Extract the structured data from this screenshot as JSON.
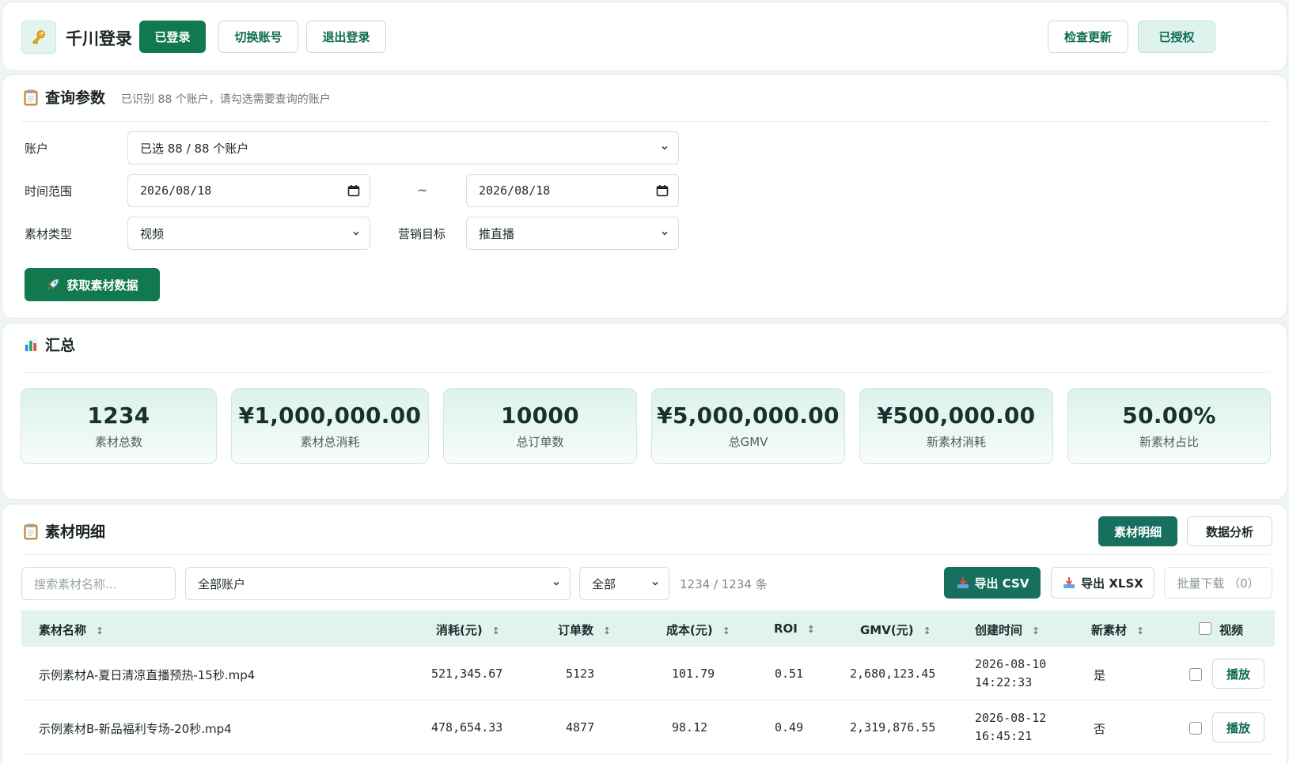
{
  "header": {
    "app_title": "千川登录",
    "logged_in_label": "已登录",
    "switch_account_label": "切换账号",
    "logout_label": "退出登录",
    "check_update_label": "检查更新",
    "authorized_label": "已授权"
  },
  "query": {
    "title": "查询参数",
    "subtitle": "已识别 88 个账户，请勾选需要查询的账户",
    "account_label": "账户",
    "account_value": "已选 88 / 88 个账户",
    "time_label": "时间范围",
    "date_start": "2026/08/18",
    "date_separator": "~",
    "date_end": "2026/08/18",
    "material_type_label": "素材类型",
    "material_type_value": "视频",
    "marketing_goal_label": "营销目标",
    "marketing_goal_value": "推直播",
    "fetch_button_label": "获取素材数据"
  },
  "summary": {
    "title": "汇总",
    "stats": [
      {
        "value": "1234",
        "label": "素材总数"
      },
      {
        "value": "¥1,000,000.00",
        "label": "素材总消耗"
      },
      {
        "value": "10000",
        "label": "总订单数"
      },
      {
        "value": "¥5,000,000.00",
        "label": "总GMV"
      },
      {
        "value": "¥500,000.00",
        "label": "新素材消耗"
      },
      {
        "value": "50.00%",
        "label": "新素材占比"
      }
    ]
  },
  "detail": {
    "title": "素材明细",
    "tab_detail": "素材明细",
    "tab_analysis": "数据分析",
    "search_placeholder": "搜索素材名称...",
    "account_filter": "全部账户",
    "status_filter": "全部",
    "count_text": "1234 / 1234 条",
    "export_csv": "导出 CSV",
    "export_xlsx": "导出 XLSX",
    "batch_download": "批量下载 （0）",
    "columns": {
      "name": "素材名称",
      "cost": "消耗(元)",
      "orders": "订单数",
      "unit_cost": "成本(元)",
      "roi": "ROI",
      "gmv": "GMV(元)",
      "created": "创建时间",
      "is_new": "新素材",
      "video": "视频"
    },
    "sort_glyph": "↕",
    "play_label": "播放",
    "rows": [
      {
        "name": "示例素材A-夏日清凉直播预热-15秒.mp4",
        "cost": "521,345.67",
        "orders": "5123",
        "unit_cost": "101.79",
        "roi": "0.51",
        "gmv": "2,680,123.45",
        "created_date": "2026-08-10",
        "created_time": "14:22:33",
        "is_new": "是"
      },
      {
        "name": "示例素材B-新品福利专场-20秒.mp4",
        "cost": "478,654.33",
        "orders": "4877",
        "unit_cost": "98.12",
        "roi": "0.49",
        "gmv": "2,319,876.55",
        "created_date": "2026-08-12",
        "created_time": "16:45:21",
        "is_new": "否"
      }
    ]
  },
  "colors": {
    "primary": "#12794f",
    "teal": "#17705d",
    "mint": "#dff3ee",
    "background": "#eef5f3"
  }
}
